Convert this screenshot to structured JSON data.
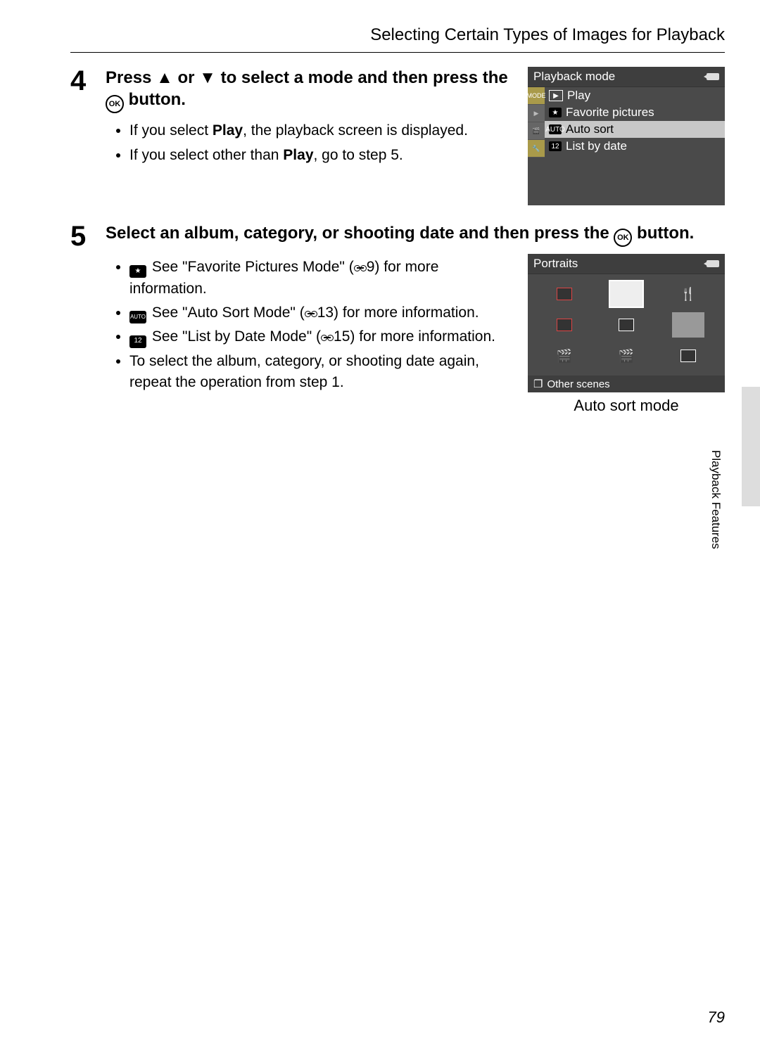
{
  "header": {
    "title": "Selecting Certain Types of Images for Playback"
  },
  "step4": {
    "number": "4",
    "head_a": "Press ",
    "head_b": " or ",
    "head_c": " to select a mode and then press the ",
    "head_d": " button.",
    "bullets": {
      "b1a": "If you select ",
      "b1_play": "Play",
      "b1b": ", the playback screen is displayed.",
      "b2a": "If you select other than ",
      "b2_play": "Play",
      "b2b": ", go to step 5."
    }
  },
  "screen1": {
    "title": "Playback mode",
    "sidetab": "MODE",
    "items": [
      {
        "icon": "▶",
        "label": "Play",
        "selected": false
      },
      {
        "icon": "★",
        "label": "Favorite pictures",
        "selected": false
      },
      {
        "icon": "AUTO",
        "label": "Auto sort",
        "selected": true
      },
      {
        "icon": "12",
        "label": "List by date",
        "selected": false
      }
    ]
  },
  "step5": {
    "number": "5",
    "head_a": "Select an album, category, or shooting date and then press the ",
    "head_b": " button.",
    "bullets": {
      "fav_a": " See \"Favorite Pictures Mode\" (",
      "fav_b": "9) for more information.",
      "auto_a": " See \"Auto Sort Mode\" (",
      "auto_b": "13) for more information.",
      "date_a": " See \"List by Date Mode\" (",
      "date_b": "15) for more information.",
      "repeat": "To select the album, category, or shooting date again, repeat the operation from step 1."
    }
  },
  "screen2": {
    "title": "Portraits",
    "footer": "Other scenes",
    "caption": "Auto sort mode"
  },
  "icons": {
    "star": "★",
    "auto": "AUTO",
    "date": "12",
    "folder": "❐"
  },
  "side_label": "Playback Features",
  "page_number": "79"
}
